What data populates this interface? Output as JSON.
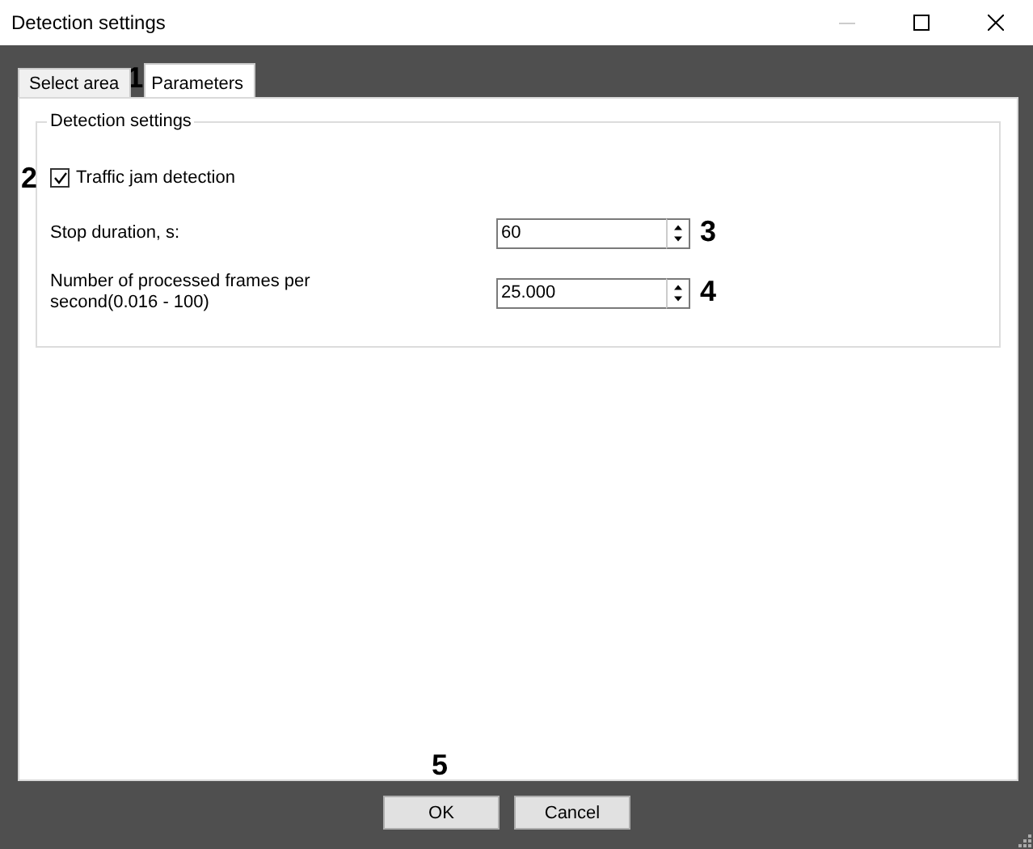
{
  "window": {
    "title": "Detection settings"
  },
  "tabs": [
    {
      "label": "Select area",
      "selected": false
    },
    {
      "label": "Parameters",
      "selected": true,
      "callout": "1"
    }
  ],
  "group": {
    "title": "Detection settings"
  },
  "checkbox": {
    "label": "Traffic jam detection",
    "checked": true,
    "callout": "2"
  },
  "fields": [
    {
      "label": "Stop duration, s:",
      "value": "60",
      "callout": "3"
    },
    {
      "label": "Number of processed frames per second(0.016 - 100)",
      "value": "25.000",
      "callout": "4"
    }
  ],
  "buttons": [
    {
      "label": "OK",
      "callout": "5"
    },
    {
      "label": "Cancel"
    }
  ]
}
